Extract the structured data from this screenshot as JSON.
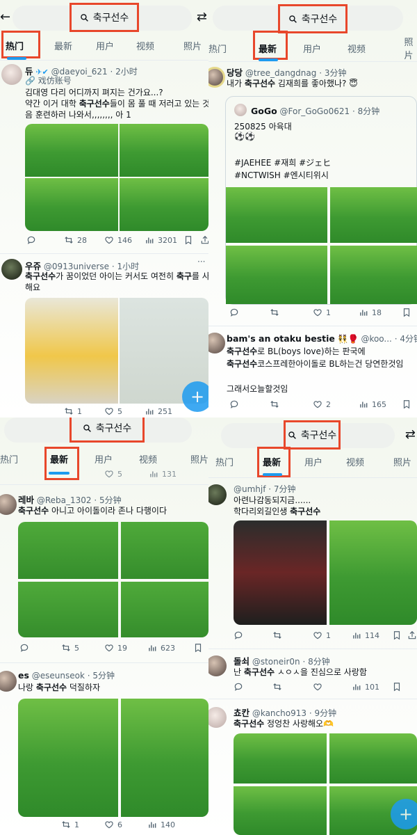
{
  "search": {
    "query": "축구선수"
  },
  "tabs": [
    "热门",
    "最新",
    "用户",
    "视频",
    "照片"
  ],
  "colors": {
    "accent": "#1d9bf0",
    "highlight": "#e8472b"
  },
  "panel1": {
    "tweet1": {
      "name": "듀",
      "badges": "✈✔",
      "handle": "@daeyoi_621",
      "time": "· 2小时",
      "sub": "🔗 戏仿账号",
      "line1": "김대영 다리 어디까지 펴지는 건가요...?",
      "line2a": "약간 이거 대학 ",
      "line2b": "축구선수",
      "line2c": "들이 몸 풀 때 저러고 있는 것 같",
      "line3": "음 훈련하러 나와서,,,,,,,, 아 1",
      "replies": "",
      "retweets": "28",
      "likes": "146",
      "views": "3201"
    },
    "tweet2": {
      "name": "우쥬",
      "handle": "@0913universe",
      "time": "· 1小时",
      "dots": "···",
      "line1a": "축구선수",
      "line1b": "가 꿈이었던 아이는 커서도 여전히 ",
      "line1c": "축구",
      "line1d": "를 사랑",
      "line2": "해요",
      "likes": "5",
      "views": "251",
      "retweets": "1"
    }
  },
  "panel2": {
    "tweet1": {
      "name": "당당",
      "handle": "@tree_dangdnag",
      "time": "· 3分钟",
      "line1a": "내가 ",
      "line1b": "축구선수",
      "line1c": " 김재희를 좋아했나? 😇",
      "quote": {
        "name": "GoGo",
        "handle": "@For_GoGo0621",
        "time": "· 8分钟",
        "line1": "250825 아육대",
        "line2": "⚽⚽",
        "line3": "#JAEHEE #재희 #ジェヒ",
        "line4": "#NCTWISH #엔시티위시"
      },
      "likes": "1",
      "views": "18"
    },
    "tweet2": {
      "name": "bam's an otaku bestie",
      "emoji": "👯🥊",
      "handle": "@koo...",
      "time": "· 4分钟",
      "line1a": "축구선수",
      "line1b": "로 BL(boys love)하는 판국에",
      "line2a": "축구선수",
      "line2b": "코스프레한아이돌로 BL하는건 당연한것임",
      "line3": "그래서오늘할것임",
      "likes": "2",
      "views": "165"
    }
  },
  "panel3": {
    "prev": {
      "likes": "5",
      "views": "131"
    },
    "tweet1": {
      "name": "레바",
      "handle": "@Reba_1302",
      "time": "· 5分钟",
      "line1a": "축구선수",
      "line1b": " 아니고 아이돌이라 존나 다행이다",
      "retweets": "5",
      "likes": "19",
      "views": "623"
    },
    "tweet2": {
      "name": "es",
      "handle": "@eseunseok",
      "time": "· 5分钟",
      "line1a": "나랑 ",
      "line1b": "축구선수",
      "line1c": " 덕질하자",
      "retweets": "1",
      "likes": "6",
      "views": "140"
    }
  },
  "panel4": {
    "tweet1": {
      "name": "",
      "handle": "@umhjf",
      "time": "· 7分钟",
      "line1": "아련나감동되지금......",
      "line2a": "학다리외길인생 ",
      "line2b": "축구선수",
      "likes": "1",
      "views": "114"
    },
    "tweet2": {
      "name": "돌쇠",
      "handle": "@stoneir0n",
      "time": "· 8分钟",
      "line1a": "난 ",
      "line1b": "축구선수",
      "line1c": " ㅅㅇㅅ을 진심으로 사랑함",
      "views": "101"
    },
    "tweet3": {
      "name": "쵸칸",
      "handle": "@kancho913",
      "time": "· 9分钟",
      "line1a": "축구선수",
      "line1b": " 정엉찬 사랑해오🫶"
    }
  }
}
